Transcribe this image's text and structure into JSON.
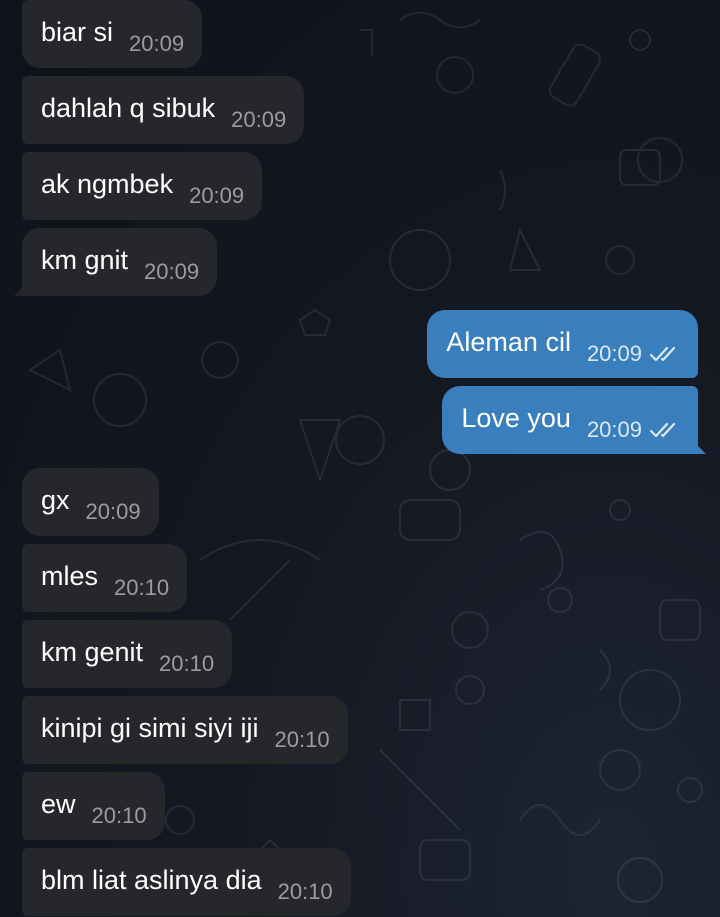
{
  "chat": {
    "messages": [
      {
        "text": "biar si",
        "time": "20:09",
        "direction": "incoming"
      },
      {
        "text": "dahlah q sibuk",
        "time": "20:09",
        "direction": "incoming"
      },
      {
        "text": "ak ngmbek",
        "time": "20:09",
        "direction": "incoming"
      },
      {
        "text": "km gnit",
        "time": "20:09",
        "direction": "incoming"
      },
      {
        "text": "Aleman cil",
        "time": "20:09",
        "direction": "outgoing",
        "status": "read"
      },
      {
        "text": "Love you",
        "time": "20:09",
        "direction": "outgoing",
        "status": "read"
      },
      {
        "text": "gx",
        "time": "20:09",
        "direction": "incoming"
      },
      {
        "text": "mles",
        "time": "20:10",
        "direction": "incoming"
      },
      {
        "text": "km genit",
        "time": "20:10",
        "direction": "incoming"
      },
      {
        "text": "kinipi gi simi siyi iji",
        "time": "20:10",
        "direction": "incoming"
      },
      {
        "text": "ew",
        "time": "20:10",
        "direction": "incoming"
      },
      {
        "text": "blm liat aslinya dia",
        "time": "20:10",
        "direction": "incoming"
      }
    ]
  },
  "colors": {
    "incoming_bubble": "#26272b",
    "outgoing_bubble": "#3a7fbd",
    "background": "#141821"
  },
  "icons": {
    "read_status": "double-check-icon"
  }
}
